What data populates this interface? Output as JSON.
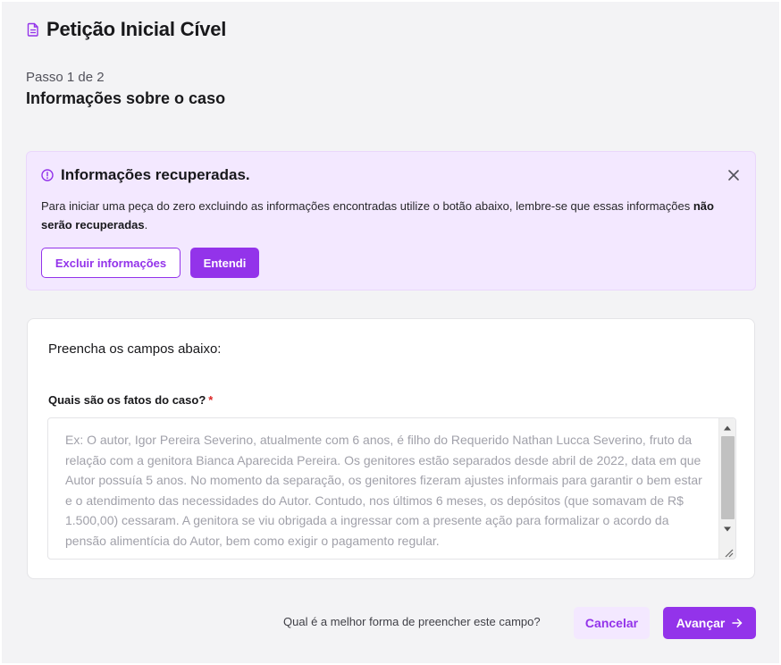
{
  "header": {
    "title": "Petição Inicial Cível",
    "icon": "document-icon"
  },
  "step": {
    "counter": "Passo 1 de 2",
    "title": "Informações sobre o caso"
  },
  "alert": {
    "title": "Informações recuperadas.",
    "icon": "info-circle-icon",
    "text_before": "Para iniciar uma peça do zero excluindo as informações encontradas utilize o botão abaixo, lembre-se que essas informações ",
    "text_bold": "não serão recuperadas",
    "text_after": ".",
    "delete_button": "Excluir informações",
    "ok_button": "Entendi"
  },
  "form": {
    "heading": "Preencha os campos abaixo:",
    "facts_label": "Quais são os fatos do caso?",
    "required_mark": "*",
    "facts_value": "",
    "facts_placeholder": "Ex: O autor, Igor Pereira Severino, atualmente com 6 anos, é filho do Requerido Nathan Lucca Severino, fruto da relação com a genitora Bianca Aparecida Pereira. Os genitores estão separados desde abril de 2022, data em que Autor possuía 5 anos. No momento da separação, os genitores fizeram ajustes informais para garantir o bem estar e o atendimento das necessidades do Autor. Contudo, nos últimos 6 meses, os depósitos (que somavam de R$ 1.500,00) cessaram. A genitora se viu obrigada a ingressar com a presente ação para formalizar o acordo da pensão alimentícia do Autor, bem como exigir o pagamento regular."
  },
  "footer": {
    "help_link": "Qual é a melhor forma de preencher este campo?",
    "cancel_button": "Cancelar",
    "next_button": "Avançar"
  },
  "colors": {
    "accent": "#9333ea",
    "alert_bg": "#f3e8ff",
    "page_bg": "#f3f3f5"
  }
}
